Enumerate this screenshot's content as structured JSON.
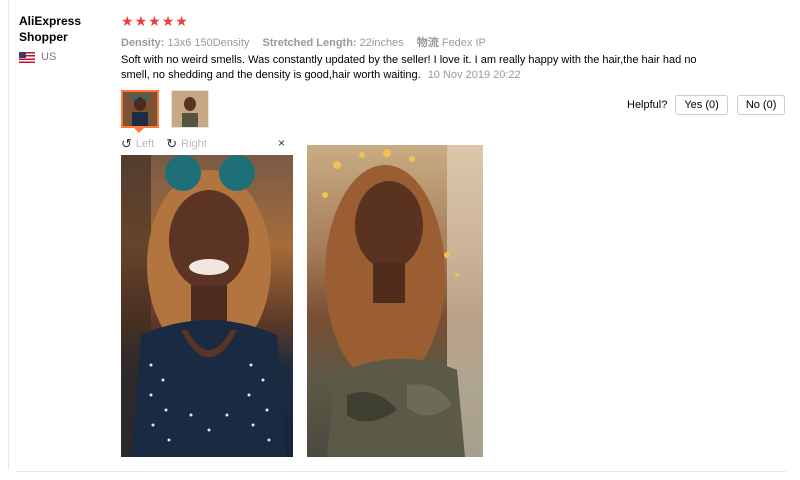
{
  "reviewer": {
    "name": "AliExpress Shopper",
    "country": "US"
  },
  "rating": {
    "stars": 5,
    "star_glyph": "★",
    "color": "#f03c3c"
  },
  "attributes": [
    {
      "key": "Density:",
      "value": "13x6 150Density"
    },
    {
      "key": "Stretched Length:",
      "value": "22inches"
    },
    {
      "key": "物流",
      "value": "Fedex IP"
    }
  ],
  "review": {
    "text": "Soft with no weird smells. Was constantly updated by the seller! I love it. I am really happy with the hair,the hair had no smell, no shedding and the density is good,hair worth waiting.",
    "date": "10 Nov 2019 20:22"
  },
  "photo_toolbar": {
    "left": "Left",
    "right": "Right",
    "close": "×"
  },
  "helpful": {
    "label": "Helpful?",
    "yes": "Yes (0)",
    "no": "No (0)"
  },
  "accent_color": "#ff7a3d"
}
